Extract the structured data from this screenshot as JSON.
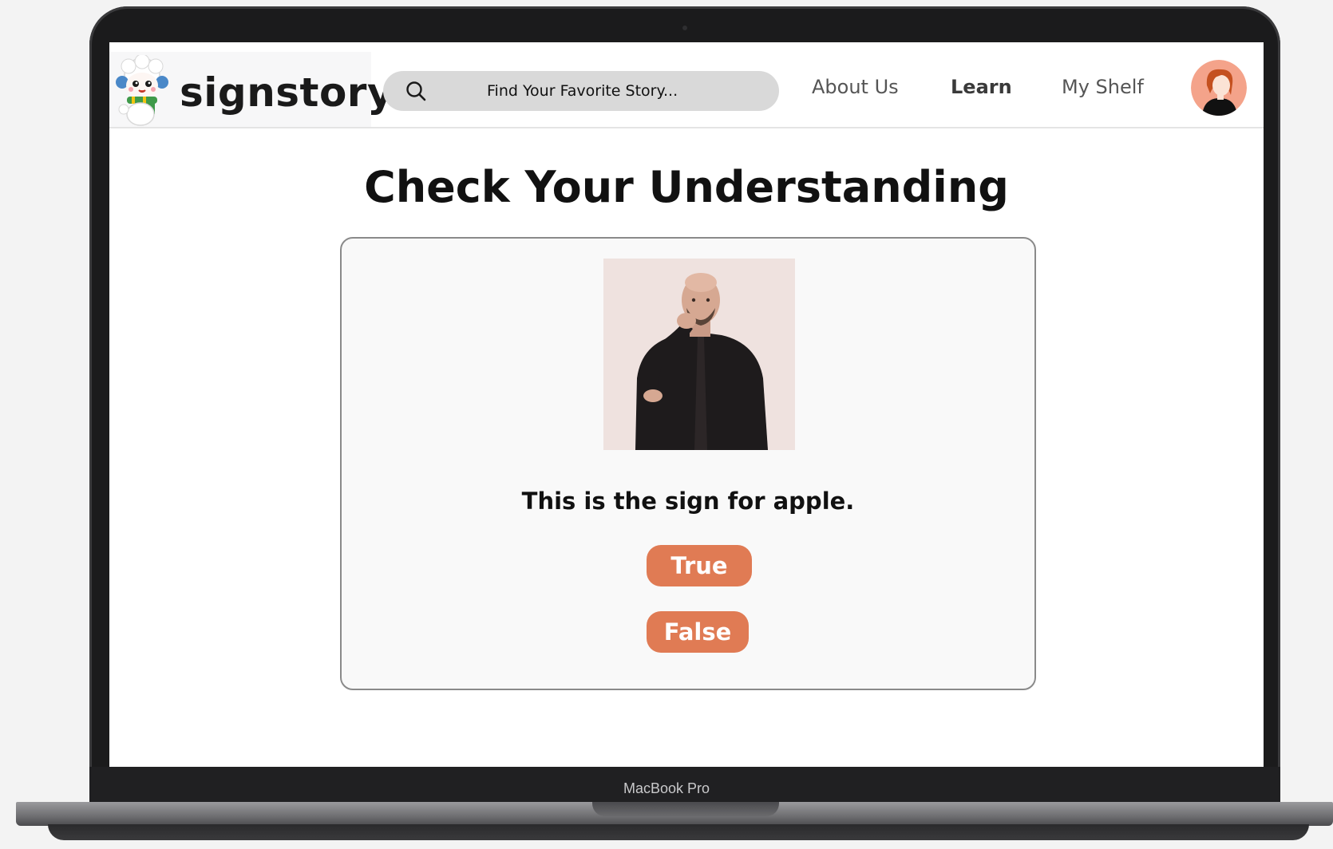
{
  "device": {
    "label": "MacBook Pro"
  },
  "header": {
    "brand": "signstory",
    "search_placeholder": "Find Your Favorite Story...",
    "nav": {
      "about": "About Us",
      "learn": "Learn",
      "shelf": "My Shelf"
    }
  },
  "main": {
    "title": "Check Your Understanding",
    "question": "This is the sign for apple.",
    "answers": {
      "true_label": "True",
      "false_label": "False"
    }
  },
  "colors": {
    "accent": "#e07b54",
    "search_bg": "#d9d9d9"
  },
  "icons": [
    "search-icon",
    "mascot-logo",
    "user-avatar",
    "sign-photo"
  ]
}
